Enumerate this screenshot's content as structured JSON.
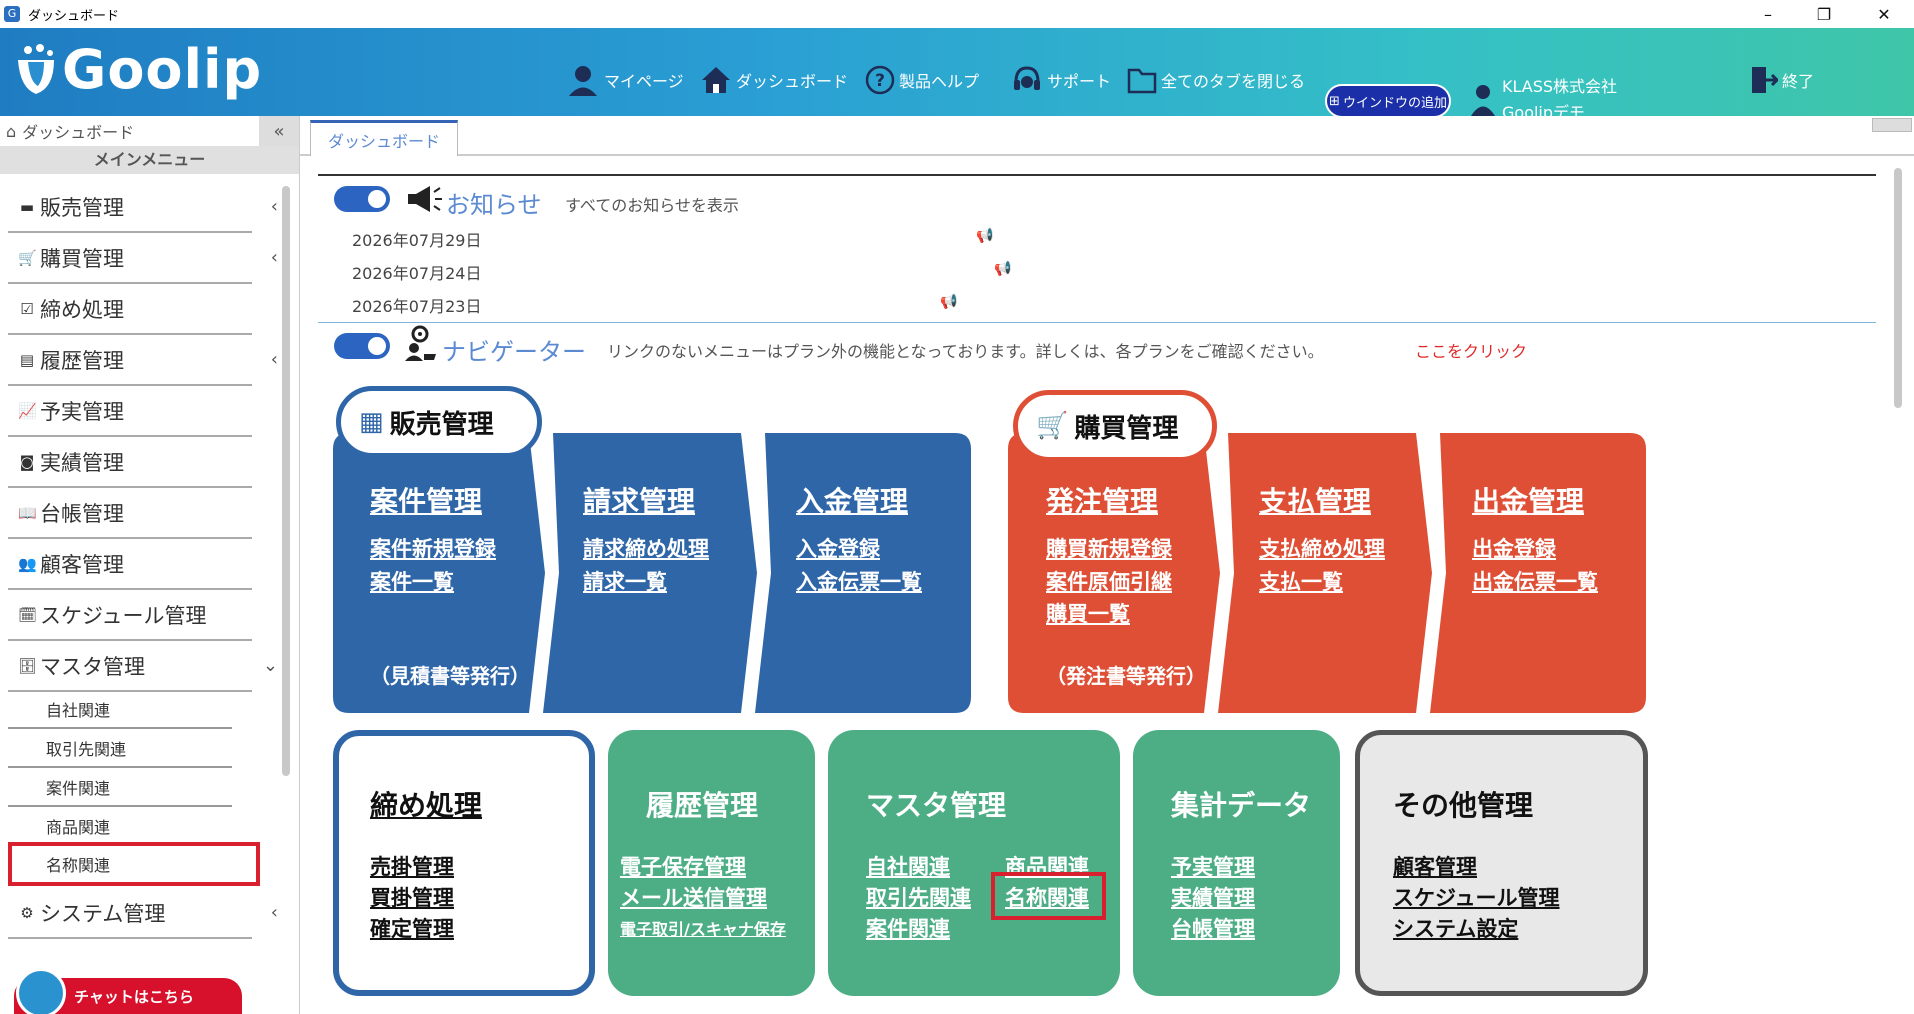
{
  "window": {
    "title": "ダッシュボード",
    "minimize": "–",
    "restore": "❐",
    "close": "✕"
  },
  "header": {
    "logo_text": "Goolip",
    "nav": {
      "mypage": "マイページ",
      "dashboard": "ダッシュボード",
      "help": "製品ヘルプ",
      "support": "サポート",
      "close_tabs": "全てのタブを閉じる",
      "add_window": "ウインドウの追加"
    },
    "company": {
      "name": "KLASS株式会社",
      "user": "Goolipデモ"
    },
    "exit": "終了"
  },
  "sidebar": {
    "top": "ダッシュボード",
    "collapse": "«",
    "main_menu": "メインメニュー",
    "items": [
      {
        "label": "販売管理",
        "icon": "▬",
        "arrow": "‹"
      },
      {
        "label": "購買管理",
        "icon": "🛒",
        "arrow": "‹"
      },
      {
        "label": "締め処理",
        "icon": "☑",
        "arrow": ""
      },
      {
        "label": "履歴管理",
        "icon": "▤",
        "arrow": "‹"
      },
      {
        "label": "予実管理",
        "icon": "📈",
        "arrow": ""
      },
      {
        "label": "実績管理",
        "icon": "◙",
        "arrow": ""
      },
      {
        "label": "台帳管理",
        "icon": "📖",
        "arrow": ""
      },
      {
        "label": "顧客管理",
        "icon": "👥",
        "arrow": ""
      },
      {
        "label": "スケジュール管理",
        "icon": "🗓",
        "arrow": ""
      },
      {
        "label": "マスタ管理",
        "icon": "🗄",
        "arrow": "⌄"
      }
    ],
    "sub_items": [
      {
        "label": "自社関連"
      },
      {
        "label": "取引先関連"
      },
      {
        "label": "案件関連"
      },
      {
        "label": "商品関連"
      },
      {
        "label": "名称関連"
      }
    ],
    "system": {
      "label": "システム管理",
      "icon": "⚙",
      "arrow": "‹"
    },
    "chat": "チャットはこちら"
  },
  "tabs": [
    {
      "label": "ダッシュボード"
    }
  ],
  "notice": {
    "title": "お知らせ",
    "all_link": "すべてのお知らせを表示",
    "dates": [
      "2026年07月29日",
      "2026年07月24日",
      "2026年07月23日"
    ]
  },
  "navigator": {
    "title": "ナビゲーター",
    "desc": "リンクのないメニューはプラン外の機能となっております。詳しくは、各プランをご確認ください。",
    "link": "ここをクリック"
  },
  "sales": {
    "badge": "販売管理",
    "steps": [
      {
        "title": "案件管理",
        "links": [
          "案件新規登録",
          "案件一覧"
        ],
        "note": "（見積書等発行）"
      },
      {
        "title": "請求管理",
        "links": [
          "請求締め処理",
          "請求一覧"
        ]
      },
      {
        "title": "入金管理",
        "links": [
          "入金登録",
          "入金伝票一覧"
        ]
      }
    ]
  },
  "purchase": {
    "badge": "購買管理",
    "steps": [
      {
        "title": "発注管理",
        "links": [
          "購買新規登録",
          "案件原価引継",
          "購買一覧"
        ],
        "note": "（発注書等発行）"
      },
      {
        "title": "支払管理",
        "links": [
          "支払締め処理",
          "支払一覧"
        ]
      },
      {
        "title": "出金管理",
        "links": [
          "出金登録",
          "出金伝票一覧"
        ]
      }
    ]
  },
  "boxes": {
    "closing": {
      "title": "締め処理",
      "links": [
        "売掛管理",
        "買掛管理",
        "確定管理"
      ]
    },
    "history": {
      "title": "履歴管理",
      "links": [
        "電子保存管理",
        "メール送信管理",
        "電子取引/スキャナ保存"
      ]
    },
    "master": {
      "title": "マスタ管理",
      "links_left": [
        "自社関連",
        "取引先関連",
        "案件関連"
      ],
      "links_right": [
        "商品関連",
        "名称関連"
      ]
    },
    "aggregate": {
      "title": "集計データ",
      "links": [
        "予実管理",
        "実績管理",
        "台帳管理"
      ]
    },
    "other": {
      "title": "その他管理",
      "links": [
        "顧客管理",
        "スケジュール管理",
        "システム設定"
      ]
    }
  },
  "colors": {
    "sales_blue": "#2f66a8",
    "purchase_red": "#de4f35",
    "green": "#4dae86",
    "highlight": "#d8202e"
  }
}
